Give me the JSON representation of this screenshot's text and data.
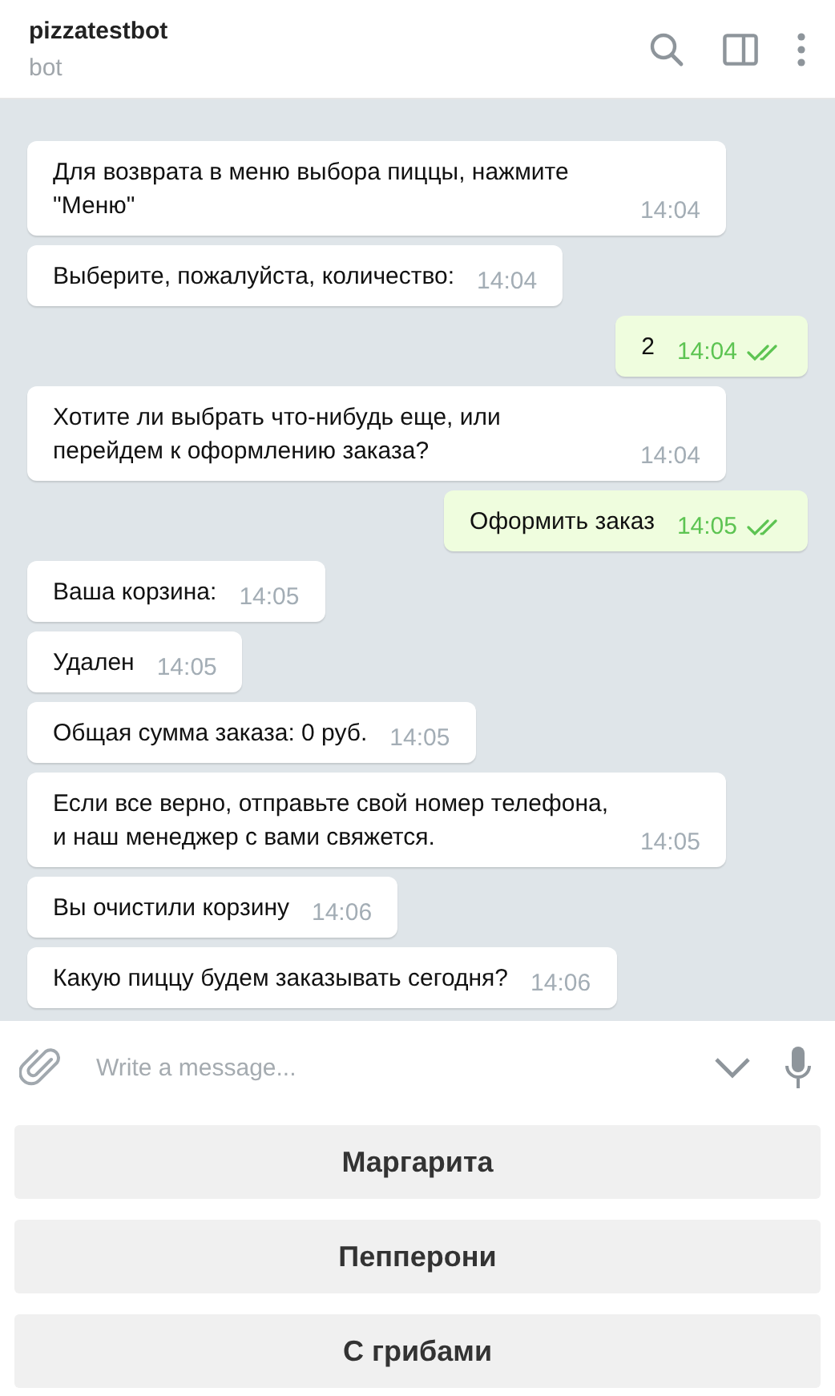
{
  "header": {
    "title": "pizzatestbot",
    "subtitle": "bot"
  },
  "messages": [
    {
      "kind": "in",
      "text": "Для возврата в меню выбора пиццы, нажмите \"Меню\"",
      "time": "14:04"
    },
    {
      "kind": "in",
      "text": "Выберите, пожалуйста, количество:",
      "time": "14:04"
    },
    {
      "kind": "out",
      "text": "2",
      "time": "14:04",
      "read": true
    },
    {
      "kind": "in",
      "text": "Хотите ли выбрать что-нибудь еще, или перейдем к оформлению заказа?",
      "time": "14:04"
    },
    {
      "kind": "out",
      "text": "Оформить заказ",
      "time": "14:05",
      "read": true
    },
    {
      "kind": "in",
      "text": "Ваша корзина:",
      "time": "14:05"
    },
    {
      "kind": "in",
      "text": "Удален",
      "time": "14:05"
    },
    {
      "kind": "in",
      "text": "Общая сумма заказа: 0 руб.",
      "time": "14:05"
    },
    {
      "kind": "in",
      "text": "Если все верно, отправьте свой номер телефона, и наш менеджер с вами свяжется.",
      "time": "14:05"
    },
    {
      "kind": "in",
      "text": "Вы очистили корзину",
      "time": "14:06"
    },
    {
      "kind": "in",
      "text": "Какую пиццу будем заказывать сегодня?",
      "time": "14:06"
    }
  ],
  "composer": {
    "placeholder": "Write a message..."
  },
  "keyboard": [
    "Маргарита",
    "Пепперони",
    "С грибами"
  ]
}
